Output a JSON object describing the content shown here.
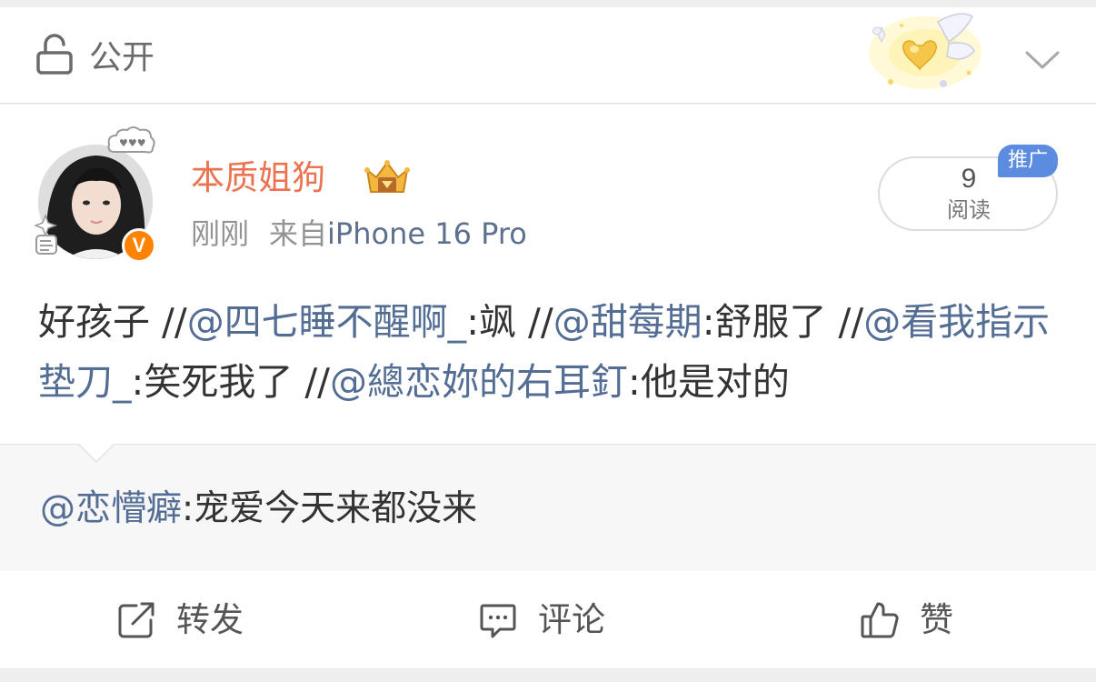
{
  "visibility": {
    "label": "公开",
    "icon": "lock-open-icon"
  },
  "post": {
    "username": "本质姐狗",
    "verified_badge": "V",
    "time": "刚刚",
    "source_prefix": "来自",
    "source": "iPhone 16 Pro",
    "read_count": "9",
    "read_label": "阅读",
    "promo_label": "推广",
    "content": {
      "lead": "好孩子 ",
      "seg1_sep": "//",
      "seg1_user": "@四七睡不醒啊_",
      "seg1_text": ":飒 ",
      "seg2_sep": "//",
      "seg2_user": "@甜莓期",
      "seg2_text": ":舒服了 ",
      "seg3_sep": "//",
      "seg3_user": "@看我指示垫刀_",
      "seg3_text": ":笑死我了 ",
      "seg4_sep": "//",
      "seg4_user": "@總恋妳的右耳釘",
      "seg4_text": ":他是对的"
    }
  },
  "retweet": {
    "user": "@恋懵癖",
    "text": ":宠爱今天来都没来"
  },
  "actions": {
    "share_label": "转发",
    "comment_label": "评论",
    "like_label": "赞"
  },
  "colors": {
    "username": "#eb7350",
    "mention": "#536d94",
    "verified": "#ff8200",
    "promo": "#5b8ce0"
  }
}
